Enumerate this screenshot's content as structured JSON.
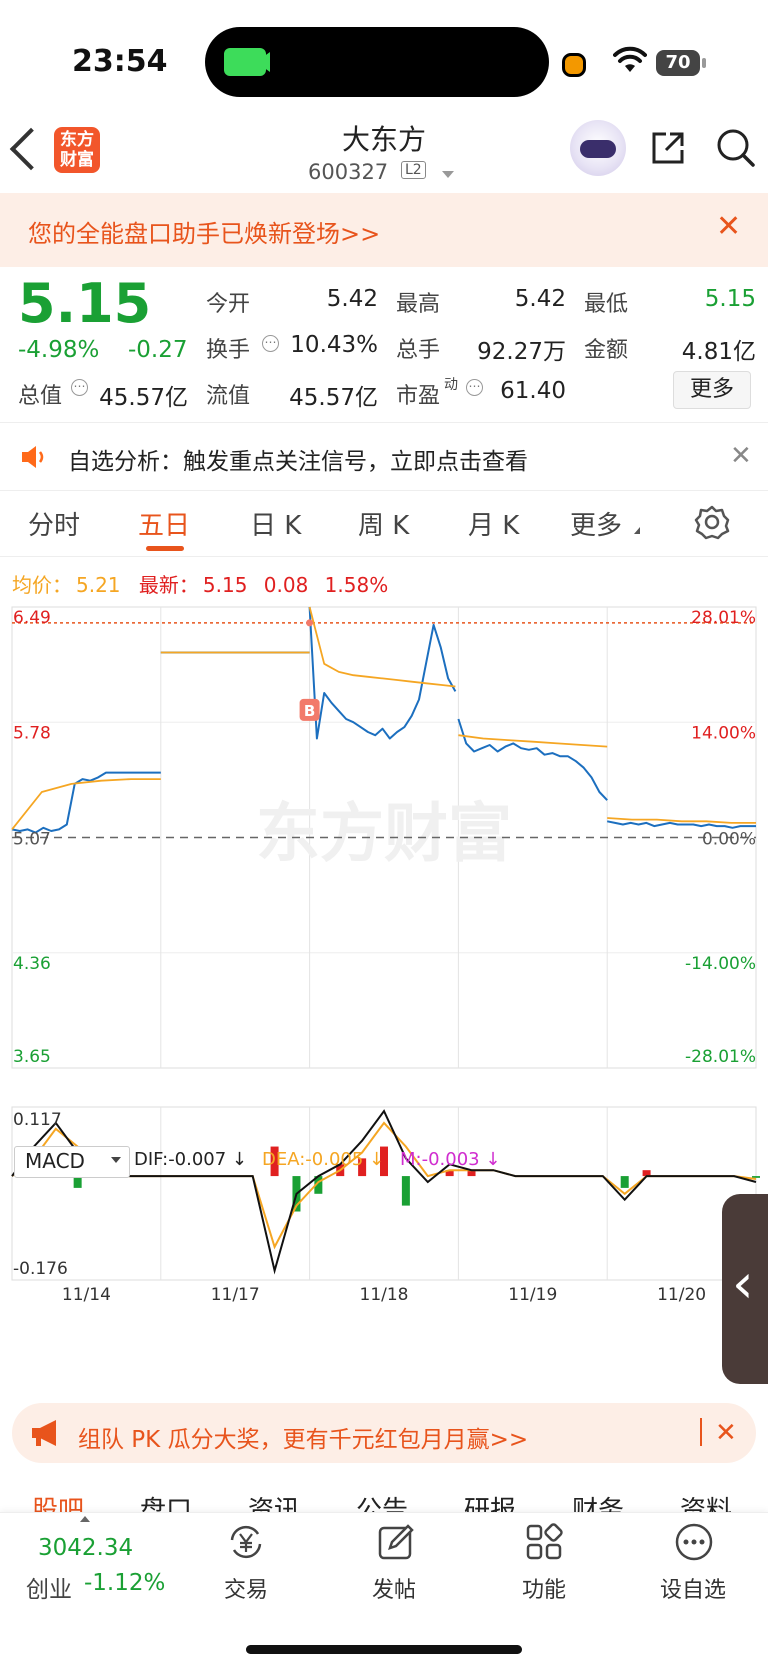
{
  "status_bar": {
    "time": "23:54",
    "battery": "70"
  },
  "header": {
    "logo_text": "东方财富",
    "stock_name": "大东方",
    "stock_code": "600327",
    "level_badge": "L2"
  },
  "banner_top": {
    "text": "您的全能盘口助手已焕新登场>>",
    "close": "✕"
  },
  "quote": {
    "price": "5.15",
    "change_pct": "-4.98%",
    "change": "-0.27",
    "rows": [
      [
        {
          "label": "今开",
          "value": "5.42"
        },
        {
          "label": "最高",
          "value": "5.42"
        },
        {
          "label": "最低",
          "value": "5.15"
        }
      ],
      [
        {
          "label": "换手",
          "value": "10.43%"
        },
        {
          "label": "总手",
          "value": "92.27万"
        },
        {
          "label": "金额",
          "value": "4.81亿"
        }
      ],
      [
        {
          "label": "总值",
          "value": "45.57亿"
        },
        {
          "label": "流值",
          "value": "45.57亿"
        },
        {
          "label": "市盈",
          "label_sup": "动",
          "value": "61.40"
        }
      ]
    ],
    "more_button": "更多",
    "colors": {
      "down": "#1aa034",
      "up": "#e02020"
    }
  },
  "alert": {
    "text": "自选分析：触发重点关注信号，立即点击查看",
    "close": "✕"
  },
  "tabs": {
    "items": [
      "分时",
      "五日",
      "日 K",
      "周 K",
      "月 K",
      "更多"
    ],
    "active": "五日"
  },
  "legend": {
    "avg_label": "均价：",
    "avg_value": "5.21",
    "latest_label": "最新：",
    "latest_value": "5.15",
    "latest_change": "0.08",
    "latest_pct": "1.58%"
  },
  "chart_data": [
    {
      "type": "line",
      "y_left_ticks": [
        "6.49",
        "5.78",
        "5.07",
        "4.36",
        "3.65"
      ],
      "y_right_ticks": [
        "28.01%",
        "14.00%",
        "0.00%",
        "-14.00%",
        "-28.01%"
      ],
      "ylim": [
        3.65,
        6.49
      ],
      "prev_close": 5.07,
      "marker": "B",
      "watermark": "东方财富",
      "x_labels": [
        "11/14",
        "11/17",
        "11/18",
        "11/19",
        "11/20"
      ],
      "series": [
        {
          "name": "最新",
          "color": "#1c6fbf",
          "days": [
            [
              5.12,
              5.11,
              5.12,
              5.1,
              5.13,
              5.11,
              5.12,
              5.15,
              5.4,
              5.43,
              5.42,
              5.44,
              5.47,
              5.47,
              5.47,
              5.47,
              5.47,
              5.47,
              5.47,
              5.47
            ],
            [
              6.21,
              6.21,
              6.21,
              6.21,
              6.21,
              6.21,
              6.21,
              6.21,
              6.21,
              6.21,
              6.21,
              6.21,
              6.21,
              6.21,
              6.21,
              6.21,
              6.21,
              6.21,
              6.21,
              6.21
            ],
            [
              6.49,
              5.68,
              5.96,
              5.9,
              5.85,
              5.8,
              5.78,
              5.75,
              5.72,
              5.7,
              5.74,
              5.68,
              5.72,
              5.75,
              5.82,
              5.92,
              6.15,
              6.38,
              6.24,
              6.05,
              5.97
            ],
            [
              5.8,
              5.65,
              5.6,
              5.62,
              5.64,
              5.6,
              5.63,
              5.65,
              5.62,
              5.61,
              5.62,
              5.58,
              5.59,
              5.57,
              5.57,
              5.54,
              5.5,
              5.44,
              5.35,
              5.3
            ],
            [
              5.17,
              5.16,
              5.15,
              5.16,
              5.15,
              5.16,
              5.14,
              5.15,
              5.16,
              5.15,
              5.15,
              5.15,
              5.14,
              5.15,
              5.14,
              5.14,
              5.13,
              5.14,
              5.14,
              5.14
            ]
          ]
        },
        {
          "name": "均价",
          "color": "#f5a623",
          "days": [
            [
              5.12,
              5.35,
              5.4,
              5.42,
              5.43,
              5.43
            ],
            [
              6.21,
              6.21,
              6.21,
              6.21
            ],
            [
              6.49,
              6.14,
              6.09,
              6.07,
              6.06,
              6.05,
              6.04,
              6.03,
              6.02,
              6.01,
              6.0
            ],
            [
              5.7,
              5.68,
              5.67,
              5.66,
              5.65,
              5.64,
              5.63
            ],
            [
              5.19,
              5.18,
              5.18,
              5.17,
              5.17,
              5.16,
              5.16
            ]
          ]
        }
      ]
    },
    {
      "type": "bar",
      "indicator": "MACD",
      "dif_label": "DIF:-0.007 ↓",
      "dea_label": "DEA:-0.005 ↓",
      "m_label": "M:-0.003 ↓",
      "ylim": [
        -0.176,
        0.117
      ],
      "y_ticks": [
        "0.117",
        "-0.176"
      ],
      "dif": [
        0.0,
        0.05,
        0.09,
        0.04,
        0.0,
        0.0,
        0.0,
        0.0,
        0.0,
        0.0,
        0.0,
        0.0,
        -0.16,
        -0.03,
        0.0,
        0.02,
        0.06,
        0.11,
        0.03,
        -0.01,
        0.02,
        0.01,
        0.01,
        0.0,
        0.0,
        0.0,
        0.0,
        0.0,
        -0.04,
        0.0,
        0.0,
        0.0,
        0.0,
        0.0,
        -0.01
      ],
      "dea": [
        0.0,
        0.03,
        0.08,
        0.05,
        0.0,
        0.0,
        0.0,
        0.0,
        0.0,
        0.0,
        0.0,
        0.0,
        -0.12,
        -0.05,
        -0.01,
        0.01,
        0.04,
        0.09,
        0.05,
        0.0,
        0.01,
        0.01,
        0.01,
        0.0,
        0.0,
        0.0,
        0.0,
        0.0,
        -0.03,
        0.0,
        0.0,
        0.0,
        0.0,
        0.0,
        -0.005
      ],
      "macd": [
        0.0,
        0.04,
        0.02,
        -0.02,
        0.0,
        0.0,
        0.0,
        0.0,
        0.0,
        0.0,
        0.0,
        0.0,
        0.05,
        -0.06,
        -0.03,
        0.02,
        0.03,
        0.05,
        -0.05,
        0.0,
        0.01,
        0.01,
        0.0,
        0.0,
        0.0,
        0.0,
        0.0,
        0.0,
        -0.02,
        0.01,
        0.0,
        0.0,
        0.0,
        0.0,
        -0.003
      ]
    }
  ],
  "banner_bottom": {
    "text": "组队 PK 瓜分大奖，更有千元红包月月赢>>",
    "close": "✕"
  },
  "sub_tabs": [
    "股吧",
    "盘口",
    "资讯",
    "公告",
    "研报",
    "财务",
    "资料"
  ],
  "bottom_bar": {
    "index_value": "3042.34",
    "index_name": "创业",
    "index_pct": "-1.12%",
    "items": [
      {
        "label": "交易",
        "icon": "yuan-exchange-icon"
      },
      {
        "label": "发帖",
        "icon": "edit-icon"
      },
      {
        "label": "功能",
        "icon": "grid-icon"
      },
      {
        "label": "设自选",
        "icon": "more-dots-icon"
      }
    ]
  }
}
